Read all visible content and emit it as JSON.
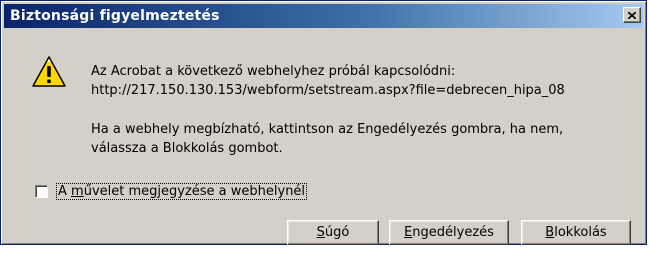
{
  "window": {
    "title": "Biztonsági figyelmeztetés",
    "close_icon": "close-x-icon",
    "warning_icon": "warning-triangle-icon"
  },
  "message": {
    "line1": "Az Acrobat a következő webhelyhez próbál kapcsolódni:",
    "line2": "http://217.150.130.153/webform/setstream.aspx?file=debrecen_hipa_08",
    "line3": "Ha a webhely megbízható, kattintson az Engedélyezés gombra, ha nem,",
    "line4": "válassza a Blokkolás gombot."
  },
  "checkbox": {
    "label_prefix": "A ",
    "label_accel": "m",
    "label_rest": "űvelet megjegyzése a webhelynél",
    "checked": false
  },
  "buttons": {
    "help_accel": "S",
    "help_rest": "úgó",
    "allow_accel": "E",
    "allow_rest": "ngedélyezés",
    "block_accel": "B",
    "block_rest": "lokkolás"
  },
  "colors": {
    "title_start": "#0a246a",
    "title_end": "#a6caf0",
    "face": "#d4d0c8",
    "warning_fill": "#ffd800"
  }
}
